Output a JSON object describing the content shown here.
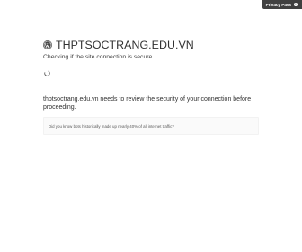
{
  "privacy_pass": {
    "label": "Privacy Pass",
    "icon": "info-icon"
  },
  "header": {
    "title": "THPTSOCTRANG.EDU.VN",
    "logo_icon": "wordpress-logo-icon"
  },
  "status": {
    "subtitle": "Checking if the site connection is secure",
    "spinner_icon": "loading-spinner-icon"
  },
  "body": {
    "description": "thptsoctrang.edu.vn needs to review the security of your connection before proceeding."
  },
  "tip": {
    "text": "Did you know bots historically made up nearly 40% of all internet traffic?"
  },
  "colors": {
    "privacy_pass_bg": "#404040",
    "text": "#313131",
    "tip_bg": "#fafafa"
  }
}
